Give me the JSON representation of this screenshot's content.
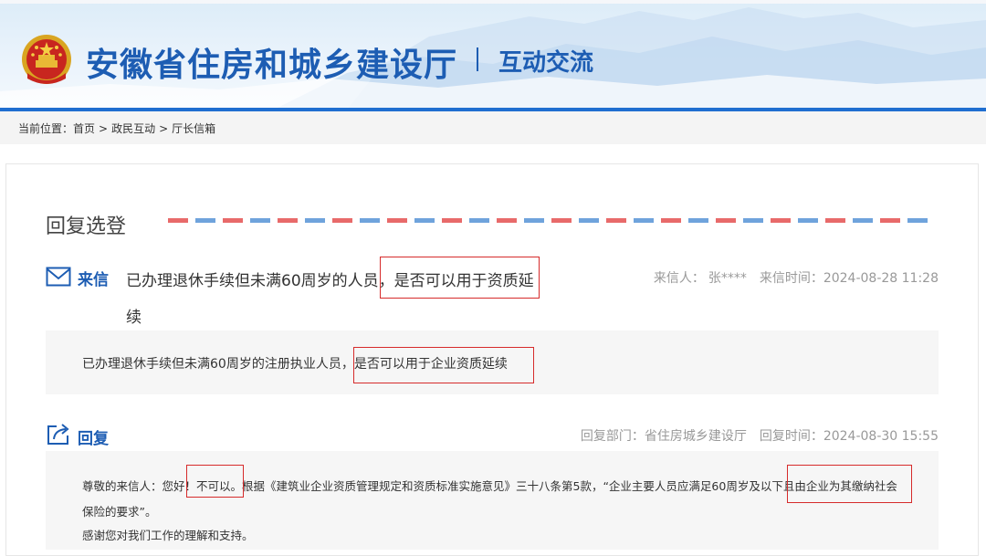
{
  "header": {
    "site_title": "安徽省住房和城乡建设厅",
    "section_title": "互动交流",
    "emblem_icon": "national-emblem-icon",
    "accent": "#1d5db3",
    "bar_color": "#1f6ed0"
  },
  "breadcrumb": {
    "prefix": "当前位置：",
    "items": [
      "首页",
      "政民互动",
      "厅长信箱"
    ],
    "separator": ">"
  },
  "main": {
    "heading": "回复选登",
    "letter": {
      "label": "来信",
      "icon": "envelope-icon",
      "title": "已办理退休手续但未满60周岁的人员，是否可以用于资质延续",
      "sender_label": "来信人：",
      "sender": "张****",
      "time_label": "来信时间：",
      "time": "2024-08-28 11:28",
      "content": "已办理退休手续但未满60周岁的注册执业人员，是否可以用于企业资质延续"
    },
    "reply": {
      "label": "回复",
      "icon": "share-reply-icon",
      "dept_label": "回复部门：",
      "dept": "省住房城乡建设厅",
      "time_label": "回复时间：",
      "time": "2024-08-30 15:55",
      "line1": "尊敬的来信人：您好！不可以。根据《建筑业企业资质管理规定和资质标准实施意见》三十八条第5款，“企业主要人员应满足60周岁及以下且由企业为其缴纳社会",
      "line2": "保险的要求”。",
      "line3": "感谢您对我们工作的理解和支持。"
    }
  },
  "highlight_color": "#d62b2b"
}
